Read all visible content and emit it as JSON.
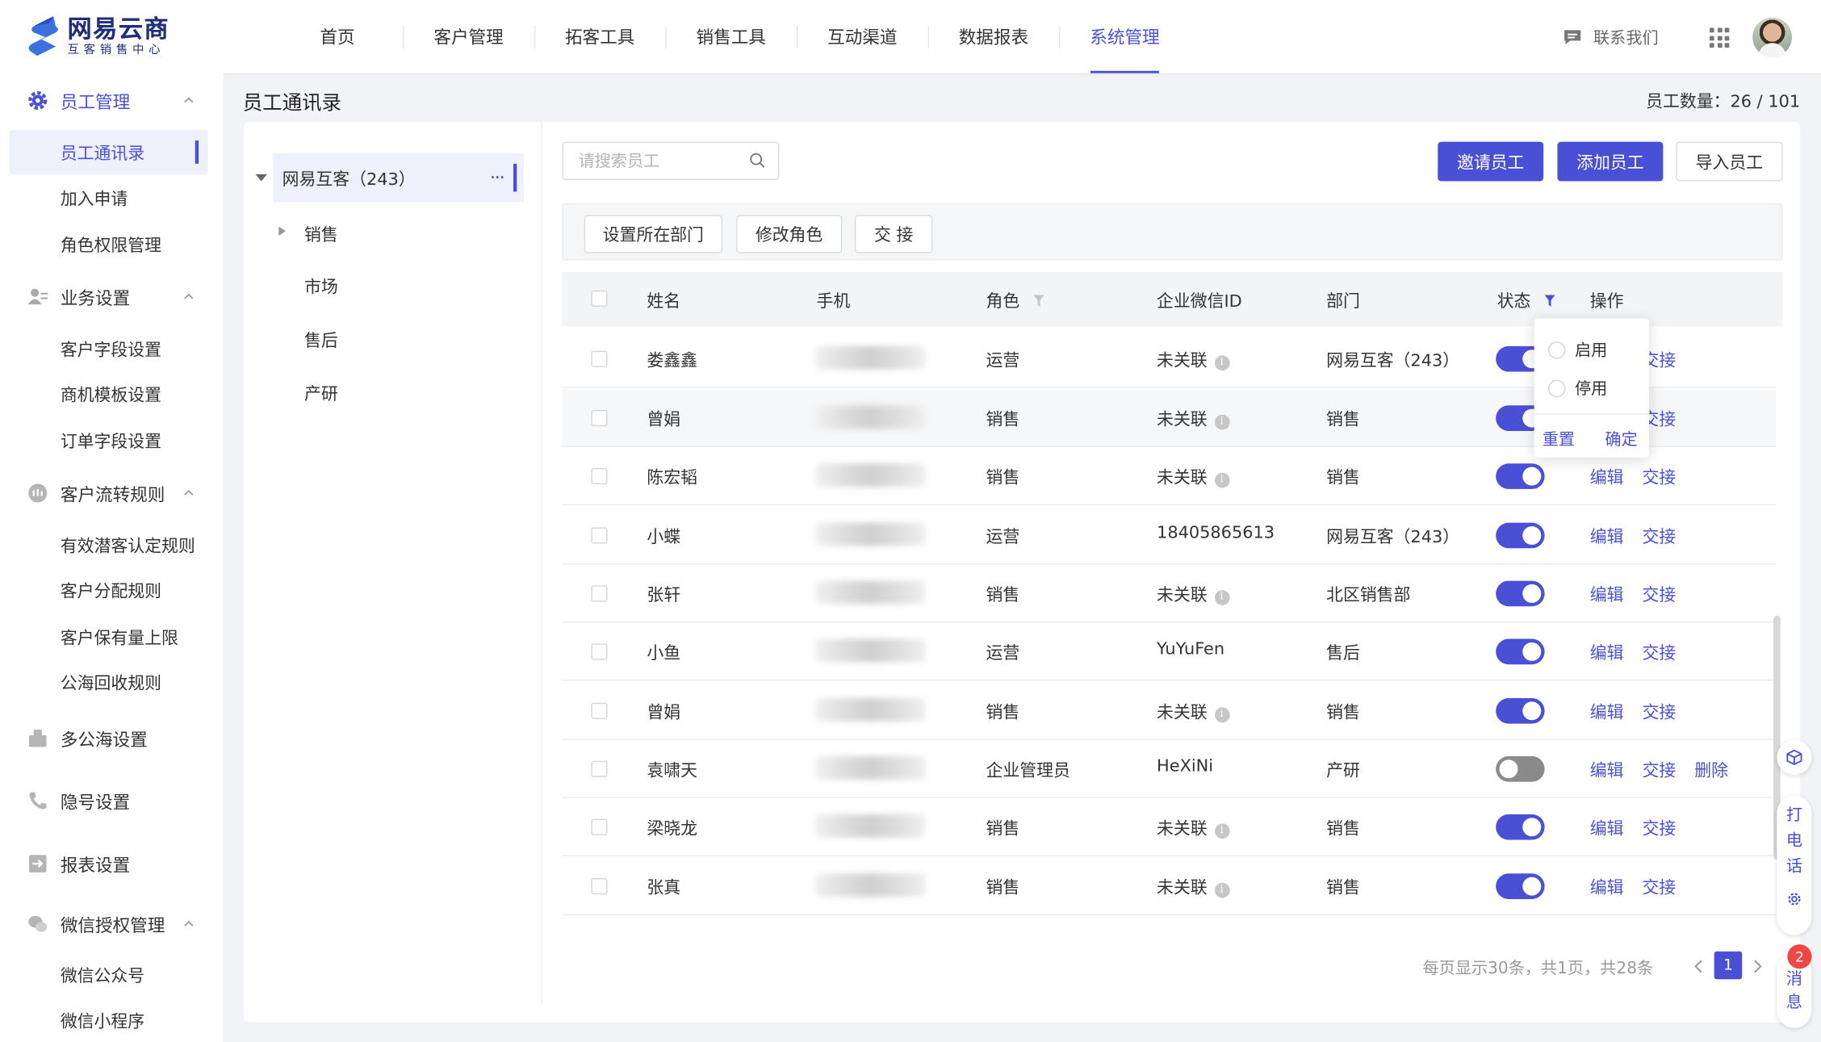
{
  "brand": {
    "title": "网易云商",
    "subtitle": "互客销售中心"
  },
  "nav": {
    "items": [
      "首页",
      "客户管理",
      "拓客工具",
      "销售工具",
      "互动渠道",
      "数据报表",
      "系统管理"
    ],
    "active": "系统管理",
    "contact_label": "联系我们"
  },
  "sidebar": {
    "employee_management": "员工管理",
    "employee_directory": "员工通讯录",
    "join_requests": "加入申请",
    "role_permissions": "角色权限管理",
    "business_settings": "业务设置",
    "customer_fields": "客户字段设置",
    "opportunity_templates": "商机模板设置",
    "order_fields": "订单字段设置",
    "customer_flow_rules": "客户流转规则",
    "lead_rules": "有效潜客认定规则",
    "assignment_rules": "客户分配规则",
    "retention_limit": "客户保有量上限",
    "pool_recycle_rules": "公海回收规则",
    "multi_pool": "多公海设置",
    "hidden_number": "隐号设置",
    "report_settings": "报表设置",
    "wechat_auth": "微信授权管理",
    "wechat_official": "微信公众号",
    "wechat_mini": "微信小程序"
  },
  "page": {
    "title": "员工通讯录",
    "employee_count_label": "员工数量：",
    "employee_count_value": "26 / 101"
  },
  "tree": {
    "root": "网易互客（243）",
    "children": [
      "销售",
      "市场",
      "售后",
      "产研"
    ]
  },
  "search": {
    "placeholder": "请搜索员工"
  },
  "actions": {
    "invite": "邀请员工",
    "add": "添加员工",
    "import": "导入员工"
  },
  "toolbar": {
    "set_department": "设置所在部门",
    "change_role": "修改角色",
    "handover": "交 接"
  },
  "table": {
    "columns": {
      "name": "姓名",
      "phone": "手机",
      "role": "角色",
      "wechat_id": "企业微信ID",
      "department": "部门",
      "status": "状态",
      "operation": "操作"
    },
    "edit_label": "编辑",
    "handover_label": "交接",
    "delete_label": "删除",
    "rows": [
      {
        "name": "娄鑫鑫",
        "role": "运营",
        "wechat_id": "未关联",
        "department": "网易互客（243）",
        "enabled": true
      },
      {
        "name": "曾娟",
        "role": "销售",
        "wechat_id": "未关联",
        "department": "销售",
        "enabled": true
      },
      {
        "name": "陈宏韬",
        "role": "销售",
        "wechat_id": "未关联",
        "department": "销售",
        "enabled": true
      },
      {
        "name": "小蝶",
        "role": "运营",
        "wechat_id": "18405865613",
        "department": "网易互客（243）",
        "enabled": true
      },
      {
        "name": "张轩",
        "role": "销售",
        "wechat_id": "未关联",
        "department": "北区销售部",
        "enabled": true
      },
      {
        "name": "小鱼",
        "role": "运营",
        "wechat_id": "YuYuFen",
        "department": "售后",
        "enabled": true
      },
      {
        "name": "曾娟",
        "role": "销售",
        "wechat_id": "未关联",
        "department": "销售",
        "enabled": true
      },
      {
        "name": "袁啸天",
        "role": "企业管理员",
        "wechat_id": "HeXiNi",
        "department": "产研",
        "enabled": false
      },
      {
        "name": "梁晓龙",
        "role": "销售",
        "wechat_id": "未关联",
        "department": "销售",
        "enabled": true
      },
      {
        "name": "张真",
        "role": "销售",
        "wechat_id": "未关联",
        "department": "销售",
        "enabled": true
      }
    ]
  },
  "status_filter": {
    "enabled": "启用",
    "disabled": "停用",
    "reset": "重置",
    "confirm": "确定"
  },
  "pagination": {
    "summary": "每页显示30条，共1页，共28条",
    "current_page": "1"
  },
  "float_widget": {
    "call_label": "打电话",
    "message_label": "消息",
    "message_badge": "2"
  },
  "colors": {
    "primary": "#4a50d6",
    "toggle_off": "#8a8a8a",
    "badge": "#f04646"
  }
}
